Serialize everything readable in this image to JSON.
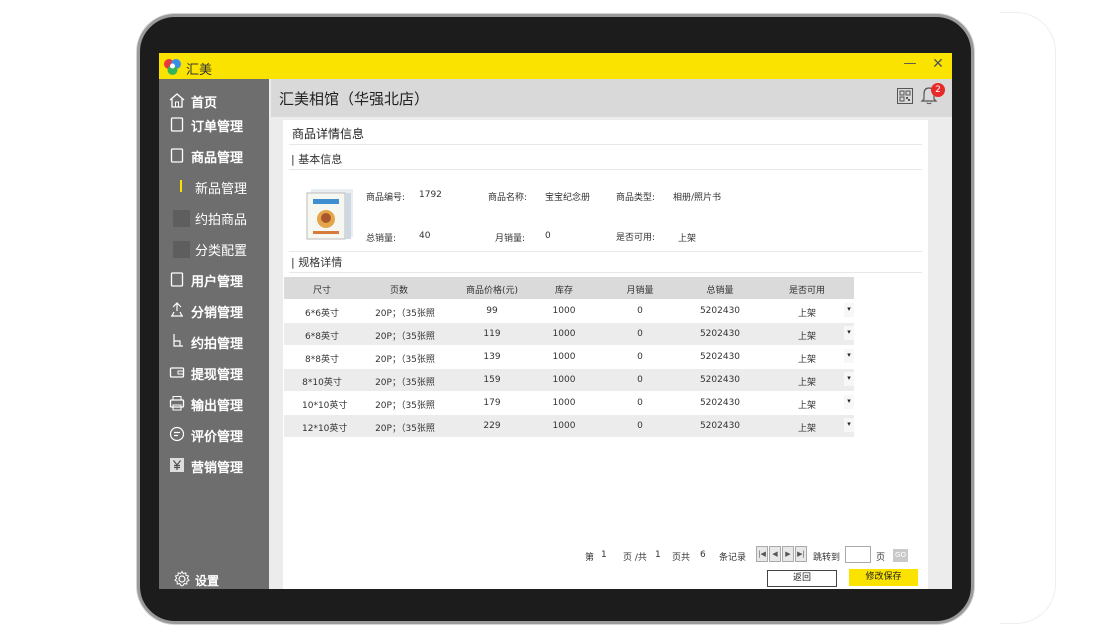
{
  "app": {
    "name": "汇美"
  },
  "window": {
    "min_icon": "minimize-icon",
    "close_icon": "close-icon"
  },
  "sidebar": {
    "items": [
      {
        "label": "首页",
        "icon": "home-icon"
      },
      {
        "label": "订单管理",
        "icon": "order-icon"
      },
      {
        "label": "商品管理",
        "icon": "goods-icon"
      },
      {
        "label": "新品管理",
        "icon": ""
      },
      {
        "label": "约拍商品",
        "icon": ""
      },
      {
        "label": "分类配置",
        "icon": ""
      },
      {
        "label": "用户管理",
        "icon": "user-icon"
      },
      {
        "label": "分销管理",
        "icon": "distribution-icon"
      },
      {
        "label": "约拍管理",
        "icon": "appointment-icon"
      },
      {
        "label": "提现管理",
        "icon": "wallet-icon"
      },
      {
        "label": "输出管理",
        "icon": "printer-icon"
      },
      {
        "label": "评价管理",
        "icon": "review-icon"
      },
      {
        "label": "营销管理",
        "icon": "yen-icon"
      }
    ],
    "settings_label": "设置"
  },
  "header": {
    "store_title": "汇美相馆（华强北店）",
    "notification_count": "2"
  },
  "page": {
    "section_title": "商品详情信息",
    "basic_info_title": "基本信息",
    "spec_title": "规格详情"
  },
  "product": {
    "code_label": "商品编号:",
    "code": "1792",
    "name_label": "商品名称:",
    "name": "宝宝纪念册",
    "type_label": "商品类型:",
    "type": "相册/照片书",
    "total_sales_label": "总销量:",
    "total_sales": "40",
    "monthly_sales_label": "月销量:",
    "monthly_sales": "0",
    "available_label": "是否可用:",
    "available": "上架"
  },
  "table": {
    "headers": [
      "尺寸",
      "页数",
      "商品价格(元)",
      "库存",
      "月销量",
      "总销量",
      "是否可用"
    ],
    "rows": [
      [
        "6*6英寸",
        "20P；（35张照",
        "99",
        "1000",
        "0",
        "5202430",
        "上架"
      ],
      [
        "6*8英寸",
        "20P；（35张照",
        "119",
        "1000",
        "0",
        "5202430",
        "上架"
      ],
      [
        "8*8英寸",
        "20P；（35张照",
        "139",
        "1000",
        "0",
        "5202430",
        "上架"
      ],
      [
        "8*10英寸",
        "20P；（35张照",
        "159",
        "1000",
        "0",
        "5202430",
        "上架"
      ],
      [
        "10*10英寸",
        "20P；（35张照",
        "179",
        "1000",
        "0",
        "5202430",
        "上架"
      ],
      [
        "12*10英寸",
        "20P；（35张照",
        "229",
        "1000",
        "0",
        "5202430",
        "上架"
      ]
    ]
  },
  "pagination": {
    "page_prefix": "第",
    "current_page": "1",
    "page_total_prefix": "页 /共",
    "total_pages": "1",
    "page_count_prefix": "页共",
    "record_count": "6",
    "record_suffix": "条记录",
    "jump_label": "跳转到",
    "jump_suffix": "页",
    "go_label": "GO"
  },
  "actions": {
    "back_label": "返回",
    "save_label": "修改保存"
  },
  "colors": {
    "accent": "#fbe300",
    "sidebar": "#6e6e6e",
    "badge": "#e62a2a"
  }
}
